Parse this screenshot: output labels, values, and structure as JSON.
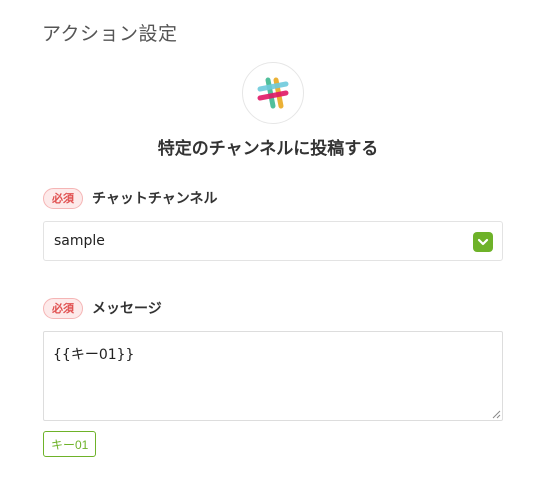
{
  "page": {
    "title": "アクション設定"
  },
  "action": {
    "app_icon": "slack-logo-icon",
    "title": "特定のチャンネルに投稿する"
  },
  "fields": {
    "channel": {
      "required_badge": "必須",
      "label": "チャットチャンネル",
      "selected_value": "sample",
      "toggle_icon": "chevron-down-icon"
    },
    "message": {
      "required_badge": "必須",
      "label": "メッセージ",
      "value": "{{キー01}}",
      "variable_chips": [
        "キー01"
      ]
    }
  },
  "colors": {
    "accent_green": "#6eb229",
    "required_red": "#e05050",
    "required_bg": "#fdeaea"
  }
}
